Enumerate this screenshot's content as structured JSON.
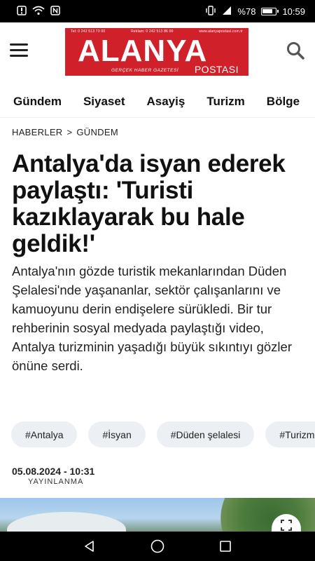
{
  "status_bar": {
    "battery": "%78",
    "time": "10:59",
    "left_icons": [
      "notification-icon",
      "wifi-icon",
      "nfc-icon"
    ],
    "right_icons": [
      "vibrate-icon",
      "signal-icon",
      "battery-icon"
    ]
  },
  "header": {
    "logo": {
      "name": "ALANYA",
      "subtitle": "POSTASI",
      "tagline": "GERÇEK HABER GAZETESİ",
      "phone1": "Tel: 0 242 513 73 00",
      "phone2": "Reklam: 0 242 513 86 00",
      "website": "www.alanyapostasi.com.tr",
      "color": "#d0202a"
    }
  },
  "nav": {
    "items": [
      "Gündem",
      "Siyaset",
      "Asayiş",
      "Turizm",
      "Bölge"
    ]
  },
  "breadcrumb": {
    "items": [
      "HABERLER",
      "GÜNDEM"
    ],
    "separator": ">"
  },
  "article": {
    "headline": "Antalya'da isyan ederek paylaştı: 'Turisti kazıklayarak bu hale geldik!'",
    "summary": "Antalya'nın gözde turistik mekanlarından Düden Şelalesi'nde yaşananlar, sektör çalışanlarını ve kamuoyunu derin endişelere sürükledi. Bir tur rehberinin sosyal medyada paylaştığı video, Antalya turizminin yaşadığı büyük sıkıntıyı gözler önüne serdi.",
    "tags": [
      "#Antalya",
      "#İsyan",
      "#Düden şelalesi",
      "#Turizm"
    ],
    "date": "05.08.2024 - 10:31",
    "published_label": "YAYINLANMA"
  },
  "system_nav": {
    "buttons": [
      "back-icon",
      "home-icon",
      "recents-icon"
    ]
  }
}
